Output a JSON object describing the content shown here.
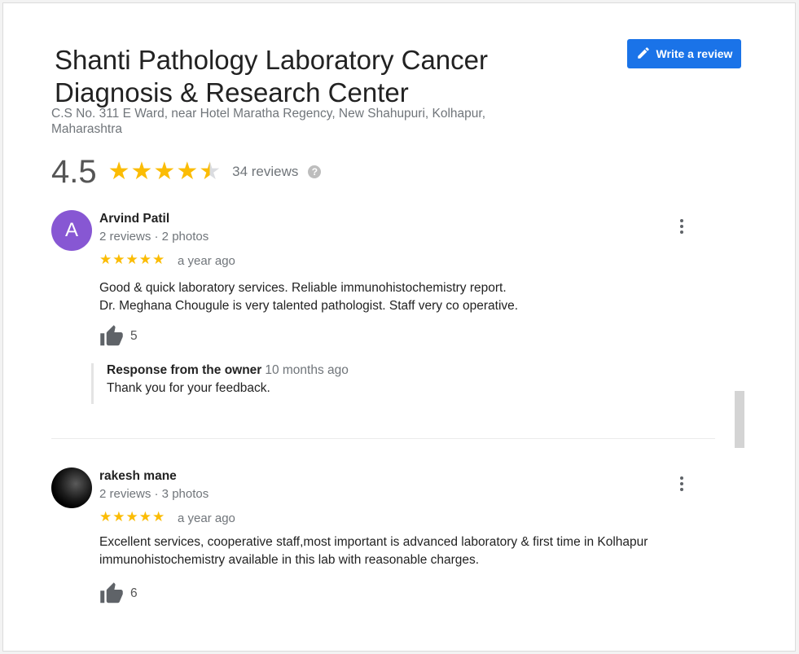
{
  "business": {
    "title_line1": "Shanti Pathology Laboratory Cancer",
    "title_line2": "Diagnosis & Research Center",
    "address_line1": "C.S No. 311 E Ward, near Hotel Maratha Regency, New Shahupuri, Kolhapur,",
    "address_line2": "Maharashtra"
  },
  "write_review": {
    "label": "Write a review",
    "icon": "pencil-icon"
  },
  "rating": {
    "value": "4.5",
    "stars": 4.5,
    "count_label": "34 reviews",
    "help_icon": "help-circle-icon",
    "help_glyph": "?"
  },
  "colors": {
    "accent": "#1a73e8",
    "star": "#fbbc04",
    "avatar_letter_bg": "#8757d3"
  },
  "reviews": [
    {
      "avatar_letter": "A",
      "name": "Arvind Patil",
      "meta": "2 reviews · 2 photos",
      "stars": 5,
      "date": "a year ago",
      "text_line1": "Good & quick laboratory services. Reliable immunohistochemistry report.",
      "text_line2": "Dr. Meghana Chougule is very talented pathologist. Staff very co operative.",
      "likes": "5",
      "owner_response": {
        "title": "Response from the owner",
        "time": "10 months ago",
        "text": "Thank you for your feedback."
      }
    },
    {
      "avatar_letter": "",
      "name": "rakesh mane",
      "meta": "2 reviews · 3 photos",
      "stars": 5,
      "date": "a year ago",
      "text_line1": "Excellent services, cooperative staff,most important is advanced laboratory & first time in Kolhapur",
      "text_line2": "immunohistochemistry available in this lab with reasonable charges.",
      "likes": "6"
    }
  ]
}
